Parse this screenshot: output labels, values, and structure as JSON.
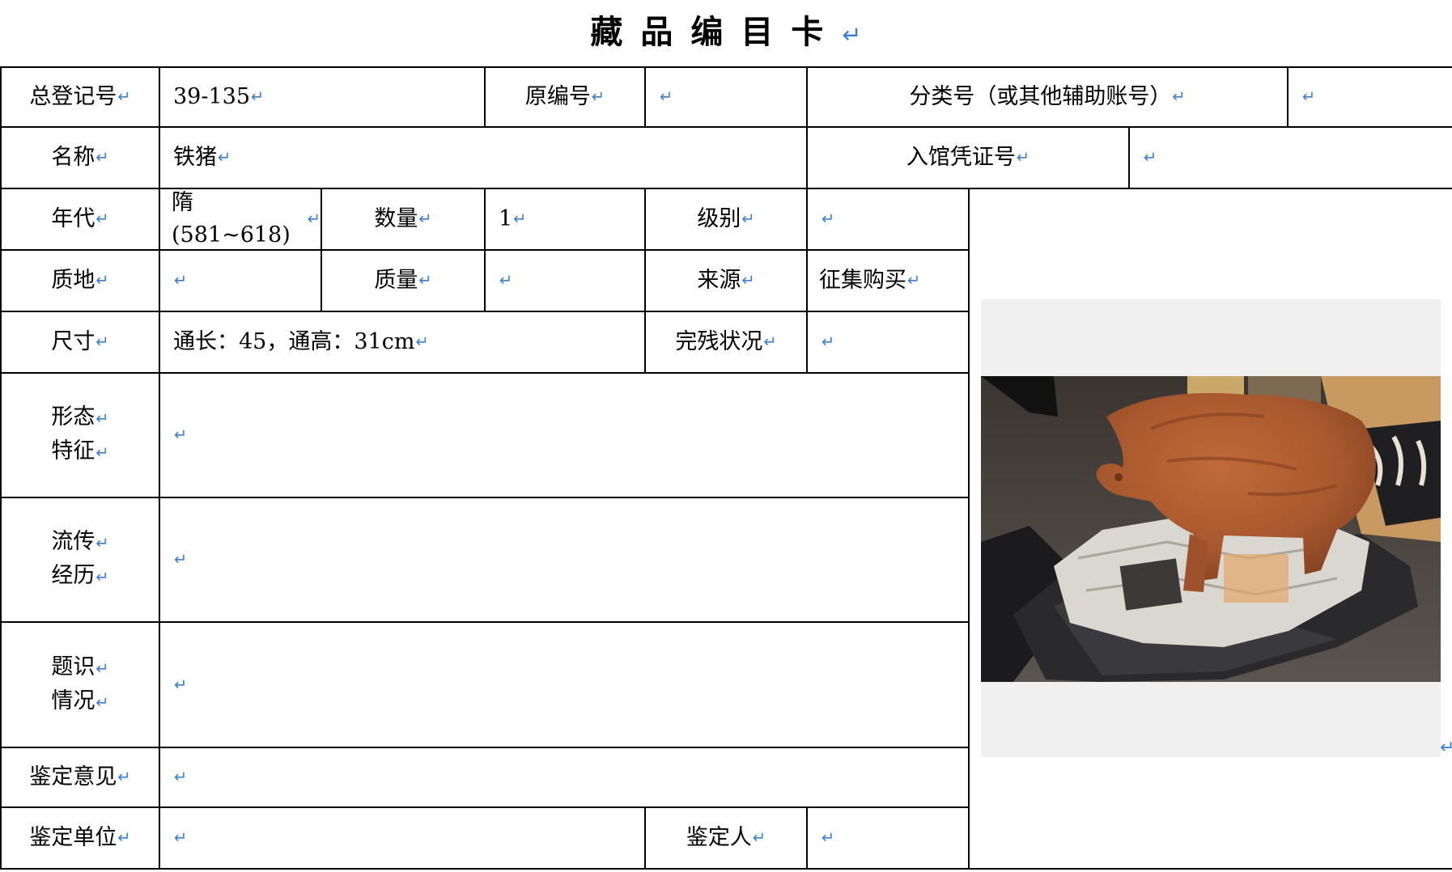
{
  "card": {
    "title": "藏品编目卡",
    "return_mark": "↵"
  },
  "fields": {
    "reg_no_label": "总登记号",
    "reg_no_value": "39-135",
    "orig_no_label": "原编号",
    "orig_no_value": "",
    "class_no_label": "分类号（或其他辅助账号）",
    "class_no_value": "",
    "name_label": "名称",
    "name_value": "铁猪",
    "voucher_label": "入馆凭证号",
    "voucher_value": "",
    "era_label": "年代",
    "era_value": "隋(581~618)",
    "qty_label": "数量",
    "qty_value": "1",
    "grade_label": "级别",
    "grade_value": "",
    "material_label": "质地",
    "material_value": "",
    "weight_label": "质量",
    "weight_value": "",
    "source_label": "来源",
    "source_value": "征集购买",
    "size_label": "尺寸",
    "size_value": "通长：45，通高：31cm",
    "condition_label": "完残状况",
    "condition_value": "",
    "form_label_1": "形态",
    "form_label_2": "特征",
    "form_value": "",
    "history_label_1": "流传",
    "history_label_2": "经历",
    "history_value": "",
    "inscription_label_1": "题识",
    "inscription_label_2": "情况",
    "inscription_value": "",
    "opinion_label": "鉴定意见",
    "opinion_value": "",
    "unit_label": "鉴定单位",
    "unit_value": "",
    "appraiser_label": "鉴定人",
    "appraiser_value": ""
  },
  "photo": {
    "subject": "rust-covered iron pig figurine on newspaper and black plastic bag",
    "colors": {
      "rust": "#a8582e",
      "bag": "#2a2a2c",
      "paper": "#d9d7cf",
      "backdrop": "#f0f0f0"
    }
  }
}
